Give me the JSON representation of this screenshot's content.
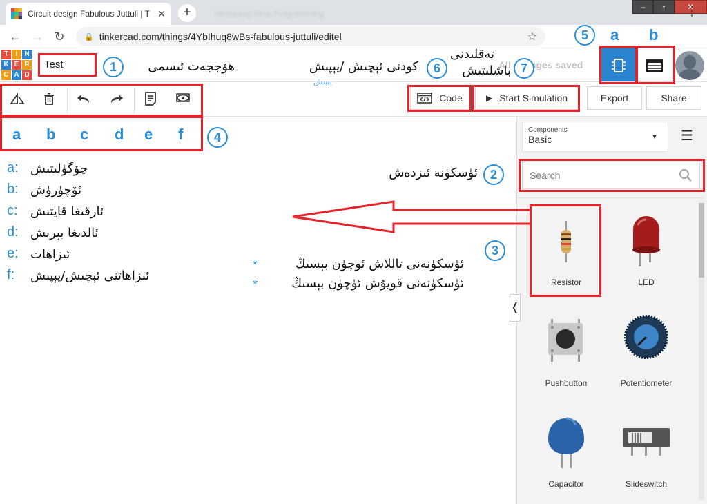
{
  "browser": {
    "tab_title": "Circuit design Fabulous Juttuli | T",
    "ghost_tab_title": "Vereaning Mruli Programming",
    "new_tab": "+",
    "url": "tinkercad.com/things/4YbIhuq8wBs-fabulous-juttuli/editel",
    "window_controls": [
      "–",
      "▫",
      "✕"
    ]
  },
  "app": {
    "logo_letters": [
      "TIN",
      "KER",
      "CAD"
    ],
    "design_name": "Test",
    "saved_status": "All changes saved",
    "buttons": {
      "code": "Code",
      "start_simulation": "Start Simulation",
      "export": "Export",
      "share": "Share"
    },
    "components_panel": {
      "select_label": "Components",
      "select_value": "Basic",
      "search_placeholder": "Search",
      "items": [
        "Resistor",
        "LED",
        "Pushbutton",
        "Potentiometer",
        "Capacitor",
        "Slideswitch"
      ]
    }
  },
  "annotations": {
    "numbers": [
      "1",
      "2",
      "3",
      "4",
      "5",
      "6",
      "7"
    ],
    "view_letters": [
      "a",
      "b"
    ],
    "tool_letters": [
      "a",
      "b",
      "c",
      "d",
      "e",
      "f"
    ],
    "project_name_label": "ھۆججەت ئىسمى",
    "code_label": "كودنى ئېچىش /يېپىش",
    "code_label_faded": "يېپىش",
    "sim_label_line1": "تەقلىدنى",
    "sim_label_line2": "باشلىتىش",
    "search_label": "ئۈسكۈنە ئىزدەش",
    "legend": [
      {
        "key": "a:",
        "text": "چۆگۈلىتىش"
      },
      {
        "key": "b:",
        "text": "ئۆچۈرۈش"
      },
      {
        "key": "c:",
        "text": "ئارقىغا قايتىش"
      },
      {
        "key": "d:",
        "text": "ئالدىغا بېرىش"
      },
      {
        "key": "e:",
        "text": "ئىزاھات"
      },
      {
        "key": "f:",
        "text": "ئىزاھاتنى ئېچىش/يېپىش"
      }
    ],
    "drag_notes": [
      {
        "bullet": "*",
        "text": "ئۈسكۈنەنى تاللاش ئۈچۈن بېسىڭ"
      },
      {
        "bullet": "*",
        "text": "ئۈسكۈنەنى قويۇش ئۈچۈن بېسىڭ"
      }
    ],
    "colors": {
      "accent": "#2a8fd6",
      "highlight_box": "#e3252b",
      "tinkercad_blue": "#2a85d0"
    }
  }
}
